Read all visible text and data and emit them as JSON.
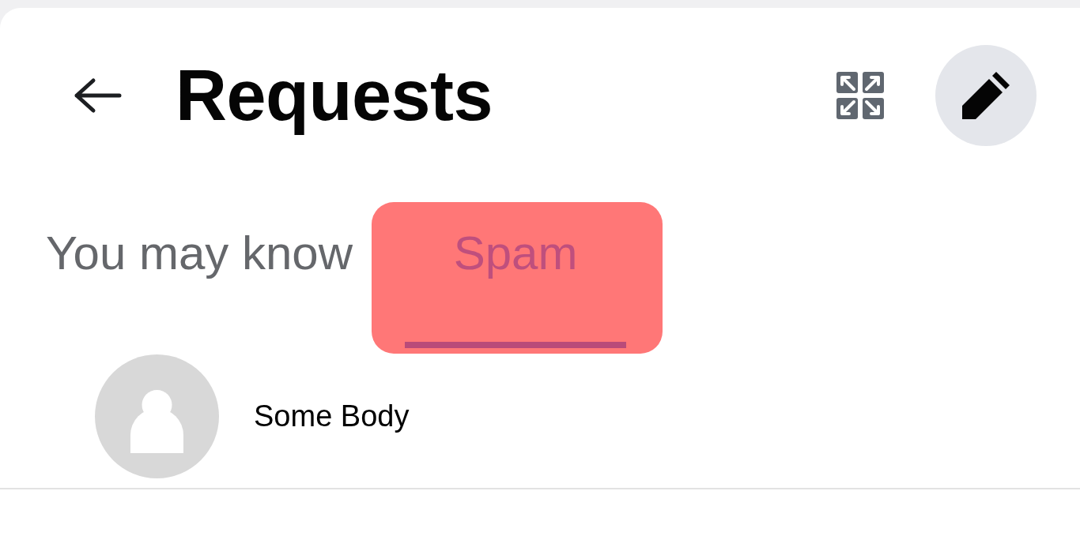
{
  "header": {
    "title": "Requests"
  },
  "tabs": [
    {
      "label": "You may know",
      "selected": false,
      "highlighted": false
    },
    {
      "label": "Spam",
      "selected": true,
      "highlighted": true
    }
  ],
  "requests": [
    {
      "name": "Some Body"
    }
  ]
}
